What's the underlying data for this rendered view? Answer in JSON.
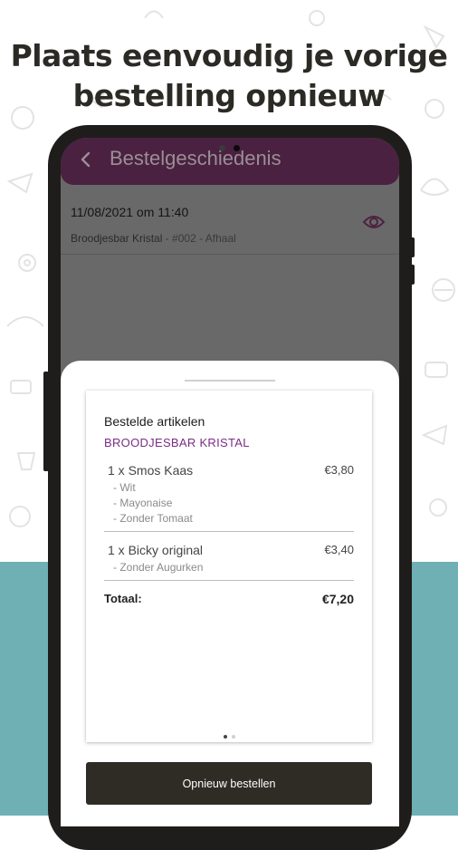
{
  "headline": {
    "line1": "Plaats eenvoudig je vorige",
    "line2": "bestelling opnieuw"
  },
  "colors": {
    "teal_band": "#6fb0b5",
    "appbar": "#4a2140",
    "accent_purple": "#7b2c86",
    "button_dark": "#2f2c26"
  },
  "appbar": {
    "back_icon": "chevron-left-icon",
    "title": "Bestelgeschiedenis"
  },
  "order": {
    "datetime": "11/08/2021 om 11:40",
    "shop": "Broodjesbar Kristal",
    "details": " - #002 - Afhaal",
    "view_icon": "eye-icon"
  },
  "sheet": {
    "card_title": "Bestelde artikelen",
    "shop_name": "BROODJESBAR KRISTAL",
    "items": [
      {
        "label": "1 x Smos Kaas",
        "price": "€3,80",
        "options": [
          "- Wit",
          "- Mayonaise",
          "- Zonder Tomaat"
        ]
      },
      {
        "label": "1 x Bicky original",
        "price": "€3,40",
        "options": [
          "- Zonder Augurken"
        ]
      }
    ],
    "total_label": "Totaal:",
    "total_value": "€7,20",
    "pager": {
      "pages": 2,
      "active": 1
    },
    "reorder_button": "Opnieuw bestellen"
  }
}
